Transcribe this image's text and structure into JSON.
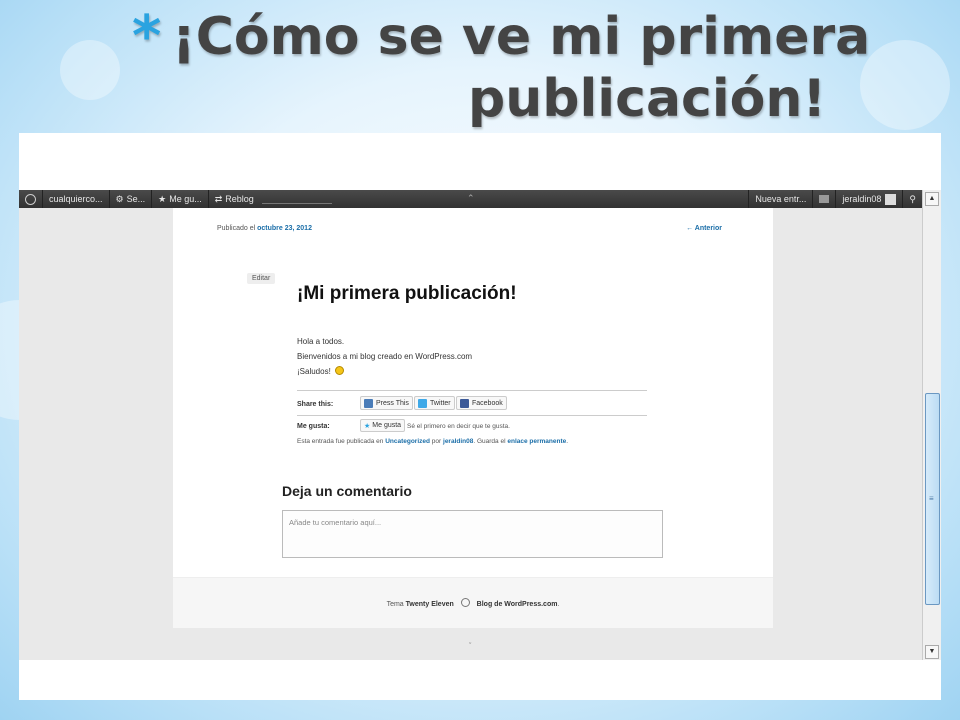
{
  "slide": {
    "title_line1": "¡Cómo se ve mi primera",
    "title_line2": "publicación!",
    "accent_color": "#2aa3e0"
  },
  "admin_bar": {
    "site": "cualquierco...",
    "item2": "Se...",
    "item3": "Me gu...",
    "reblog": "Reblog",
    "new_entry": "Nueva entr...",
    "user": "jeraldin08"
  },
  "post": {
    "published_prefix": "Publicado el",
    "date": "octubre 23, 2012",
    "prev_link": "← Anterior",
    "edit_label": "Editar",
    "title": "¡Mi primera publicación!",
    "body_lines": [
      "Hola a todos.",
      "Bienvenidos a mi blog creado en WordPress.com",
      "¡Saludos!"
    ],
    "share_label": "Share this:",
    "share_buttons": [
      "Press This",
      "Twitter",
      "Facebook"
    ],
    "like_label": "Me gusta:",
    "like_button": "Me gusta",
    "like_text": "Sé el primero en decir que te gusta.",
    "entry_footer": {
      "prefix": "Esta entrada fue publicada en",
      "category": "Uncategorized",
      "by": "por",
      "author": "jeraldin08",
      "save": ". Guarda el",
      "permalink": "enlace permanente",
      "end": "."
    }
  },
  "comments": {
    "heading": "Deja un comentario",
    "placeholder": "Añade tu comentario aquí..."
  },
  "footer": {
    "theme_prefix": "Tema",
    "theme_name": "Twenty Eleven",
    "blog_link": "Blog de WordPress.com",
    "end": "."
  },
  "colors": {
    "link": "#1b6ea8",
    "admin_bar": "#3b3b3b"
  }
}
